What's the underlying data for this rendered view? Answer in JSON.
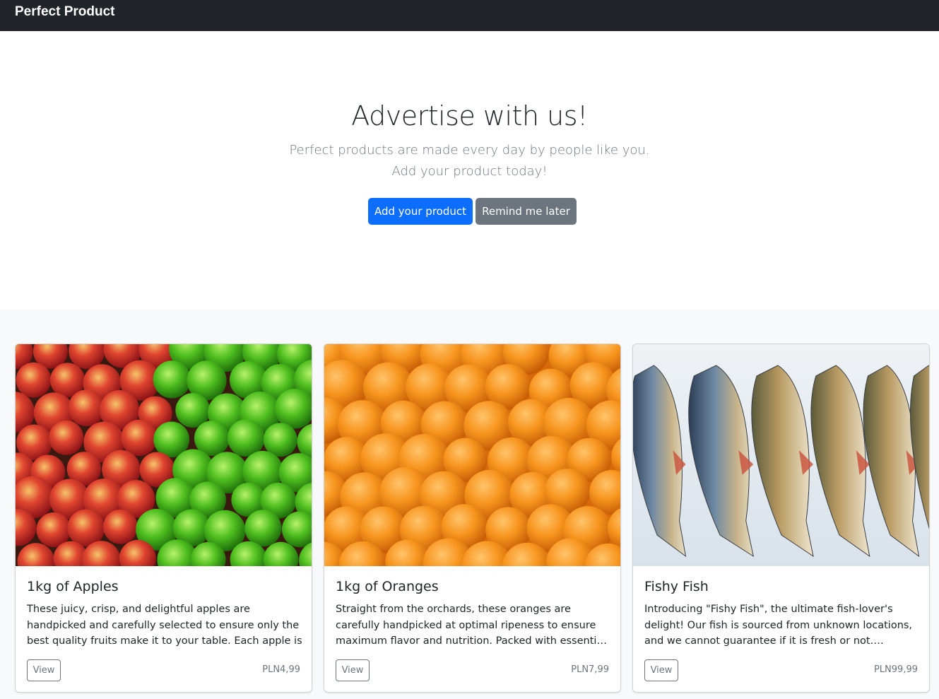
{
  "navbar": {
    "brand": "Perfect Product"
  },
  "hero": {
    "title": "Advertise with us!",
    "lead_line1": "Perfect products are made every day by people like you.",
    "lead_line2": "Add your product today!",
    "primary_button": "Add your product",
    "secondary_button": "Remind me later"
  },
  "products": [
    {
      "title": "1kg of Apples",
      "description": "These juicy, crisp, and delightful apples are handpicked and carefully selected to ensure only the best quality fruits make it to your table. Each apple is",
      "view_label": "View",
      "price": "PLN4,99",
      "image": "apples-photo"
    },
    {
      "title": "1kg of Oranges",
      "description": "Straight from the orchards, these oranges are carefully handpicked at optimal ripeness to ensure maximum flavor and nutrition. Packed with essential vitamins, minerals",
      "view_label": "View",
      "price": "PLN7,99",
      "image": "oranges-photo"
    },
    {
      "title": "Fishy Fish",
      "description": "Introducing \"Fishy Fish\", the ultimate fish-lover's delight! Our fish is sourced from unknown locations, and we cannot guarantee if it is fresh or not. However",
      "view_label": "View",
      "price": "PLN99,99",
      "image": "fish-photo"
    }
  ],
  "colors": {
    "navbar_bg": "#212529",
    "primary": "#0d6efd",
    "secondary": "#6c757d",
    "album_bg": "#f8f9fa"
  }
}
